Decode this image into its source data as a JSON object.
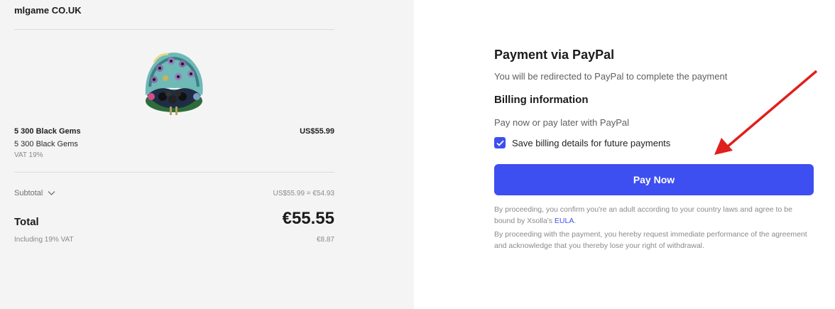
{
  "order": {
    "merchant": "mlgame CO.UK",
    "item_name": "5 300 Black Gems",
    "item_price": "US$55.99",
    "item_description": "5 300 Black Gems",
    "item_vat": "VAT 19%",
    "subtotal_label": "Subtotal",
    "subtotal_value": "US$55.99 = €54.93",
    "total_label": "Total",
    "total_value": "€55.55",
    "vat_label": "Including 19% VAT",
    "vat_value": "€8.87",
    "image_icon": "gem-chest-image"
  },
  "payment": {
    "title": "Payment via PayPal",
    "redirect_text": "You will be redirected to PayPal to complete the payment",
    "billing_title": "Billing information",
    "paypal_later": "Pay now or pay later with PayPal",
    "save_billing_label": "Save billing details for future payments",
    "save_billing_checked": true,
    "pay_button_label": "Pay Now",
    "legal_1_before": "By proceeding, you confirm you're an adult according to your country laws and agree to be bound by Xsolla's ",
    "legal_1_link": "EULA",
    "legal_1_after": ".",
    "legal_2": "By proceeding with the payment, you hereby request immediate performance of the agreement and acknowledge that you thereby lose your right of withdrawal."
  },
  "colors": {
    "accent": "#3d4ff0",
    "left_background": "#f4f4f5",
    "annotation_arrow": "#e0201c"
  }
}
